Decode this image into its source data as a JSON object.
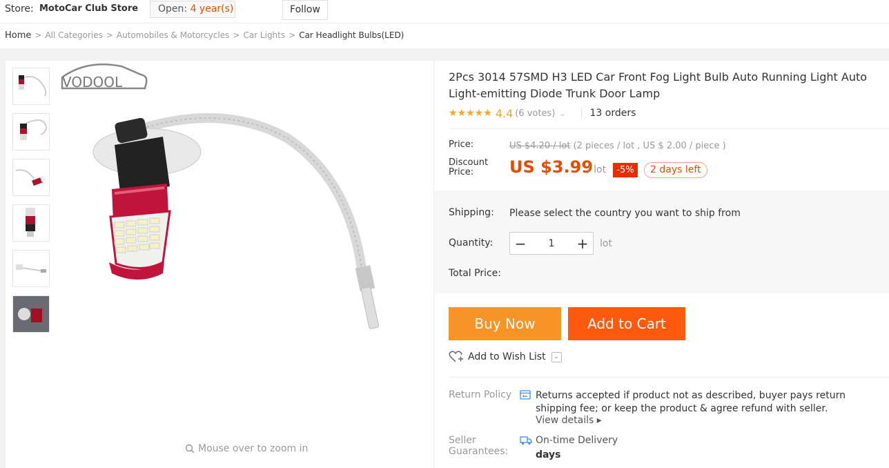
{
  "store": {
    "label": "Store:",
    "name": "MotoCar Club Store",
    "open_label": "Open:",
    "open_years": "4 year(s)",
    "follow": "Follow"
  },
  "breadcrumb": {
    "items": [
      "Home",
      "All Categories",
      "Automobiles & Motorcycles",
      "Car Lights",
      "Car Headlight Bulbs(LED)"
    ],
    "separator": ">"
  },
  "gallery": {
    "brand_logo": "VODOOL",
    "zoom_hint": "Mouse over to zoom in",
    "thumbnail_count": 6,
    "selected_thumbnail": 1
  },
  "product": {
    "title": "2Pcs 3014 57SMD H3 LED Car Front Fog Light Bulb Auto Running Light Auto Light-emitting Diode Trunk Door Lamp",
    "stars": "★★★★★",
    "rating": "4.4",
    "votes": "(6 votes)",
    "orders": "13 orders"
  },
  "pricing": {
    "price_label": "Price:",
    "original_price": "US $4.20 / lot",
    "original_detail": "(2 pieces / lot , US $ 2.00 / piece )",
    "discount_label_1": "Discount",
    "discount_label_2": "Price:",
    "discount_price": "US $3.99",
    "per_lot": "/ lot",
    "discount_pct": "-5%",
    "days_left": "2 days left"
  },
  "options": {
    "shipping_label": "Shipping:",
    "shipping_text": "Please select the country you want to ship from",
    "quantity_label": "Quantity:",
    "quantity_minus": "−",
    "quantity_value": "1",
    "quantity_plus": "+",
    "unit": "lot",
    "total_label": "Total Price:"
  },
  "actions": {
    "buy_now": "Buy Now",
    "add_to_cart": "Add to Cart",
    "wish_list": "Add to Wish List"
  },
  "policy": {
    "return_label": "Return Policy",
    "return_text": "Returns accepted if product not as described, buyer pays return shipping fee; or keep the product & agree refund with seller.",
    "view_details": "View details ▸",
    "seller_label_1": "Seller",
    "seller_label_2": "Guarantees:",
    "delivery_text": "On-time Delivery",
    "delivery_days": "days"
  },
  "colors": {
    "accent": "#e64c00",
    "buy_now": "#f89426",
    "add_to_cart": "#fd5a10",
    "star": "#f5a623"
  }
}
